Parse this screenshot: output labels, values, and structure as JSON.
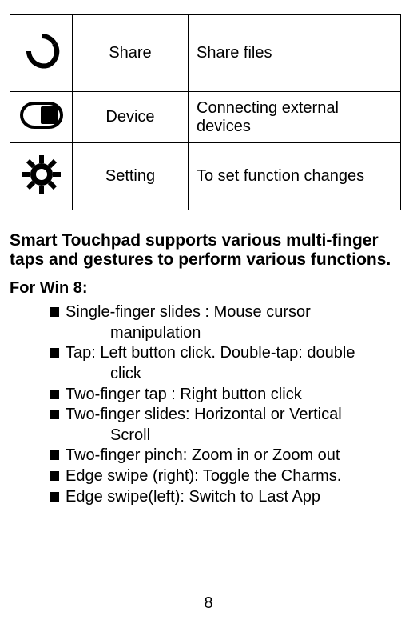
{
  "table": {
    "rows": [
      {
        "id": "share",
        "icon": "share-icon",
        "label": "Share",
        "desc": "Share files"
      },
      {
        "id": "device",
        "icon": "device-icon",
        "label": "Device",
        "desc": "Connecting external devices"
      },
      {
        "id": "setting",
        "icon": "setting-icon",
        "label": "Setting",
        "desc": "To set function changes"
      }
    ]
  },
  "heading": "Smart Touchpad supports various multi-finger taps and gestures to perform various functions.",
  "subheading": "For Win 8:",
  "gestures": [
    {
      "text": "Single-finger slides : Mouse cursor",
      "cont": "manipulation"
    },
    {
      "text": "Tap: Left button click. Double-tap: double",
      "cont": "click"
    },
    {
      "text": "Two-finger tap : Right button click"
    },
    {
      "text": "Two-finger slides: Horizontal or Vertical",
      "cont": "Scroll"
    },
    {
      "text": "Two-finger pinch: Zoom in or Zoom out"
    },
    {
      "text": "Edge swipe (right): Toggle the Charms."
    },
    {
      "text": "Edge swipe(left): Switch to Last App"
    }
  ],
  "page_number": "8"
}
